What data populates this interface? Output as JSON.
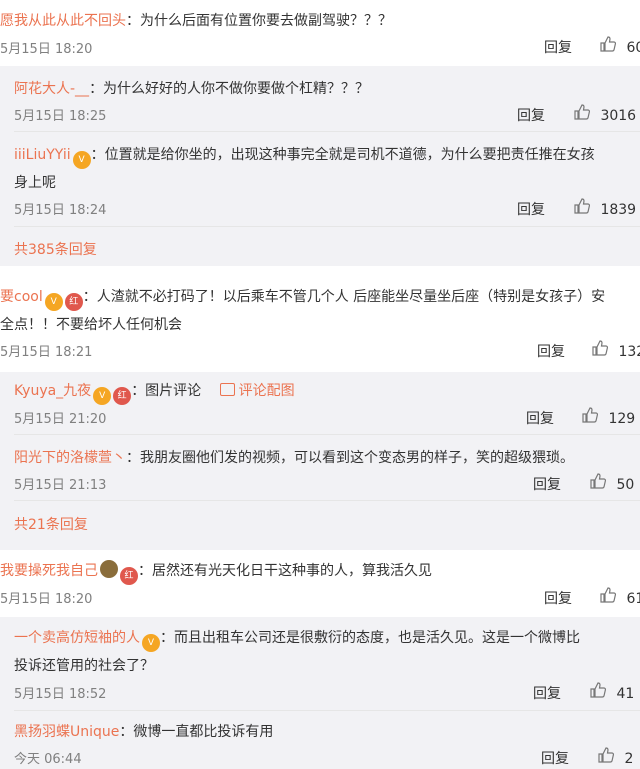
{
  "comments": [
    {
      "user": "愿我从此从此不回头",
      "text": "：为什么后面有位置你要去做副驾驶？？？",
      "time": "5月15日 18:20",
      "reply": "回复",
      "likes": "60",
      "replies": [
        {
          "user": "阿花大人-__",
          "text": "：为什么好好的人你不做你要做个杠精？？？",
          "time": "5月15日 18:25",
          "reply": "回复",
          "likes": "3016"
        },
        {
          "user": "iiiLiuYYii",
          "text_line1": "：位置就是给你坐的，出现这种事完全就是司机不道德，为什么要把责任推在女孩",
          "text_line2": "身上呢",
          "time": "5月15日 18:24",
          "reply": "回复",
          "likes": "1839"
        }
      ],
      "more": "共385条回复"
    },
    {
      "user": "要cool",
      "text_line1": "：人渣就不必打码了！以后乘车不管几个人 后座能坐尽量坐后座（特别是女孩子）安",
      "text_line2": "全点！！不要给坏人任何机会",
      "time": "5月15日 18:21",
      "reply": "回复",
      "likes": "132",
      "replies": [
        {
          "user": "Kyuya_九夜",
          "text": "：图片评论",
          "link": "评论配图",
          "time": "5月15日 21:20",
          "reply": "回复",
          "likes": "129"
        },
        {
          "user": "阳光下的洛檬萱丶",
          "text": "：我朋友圈他们发的视频，可以看到这个变态男的样子，笑的超级猥琐。",
          "time": "5月15日 21:13",
          "reply": "回复",
          "likes": "50"
        }
      ],
      "more": "共21条回复"
    },
    {
      "user": "我要操死我自己",
      "text": "：居然还有光天化日干这种事的人，算我活久见",
      "time": "5月15日 18:20",
      "reply": "回复",
      "likes": "61",
      "replies": [
        {
          "user": "一个卖高仿短袖的人",
          "text_line1": "：而且出租车公司还是很敷衍的态度，也是活久见。这是一个微博比",
          "text_line2": "投诉还管用的社会了？",
          "time": "5月15日 18:52",
          "reply": "回复",
          "likes": "41"
        },
        {
          "user": "黑扬羽蝶Unique",
          "text": "：微博一直都比投诉有用",
          "time": "今天 06:44",
          "reply": "回复",
          "likes": "2"
        }
      ]
    }
  ],
  "badges": {
    "vip": "V",
    "red": "红"
  },
  "colors": {
    "name": "#eb7350",
    "sub_bg": "#f2f2f5"
  }
}
